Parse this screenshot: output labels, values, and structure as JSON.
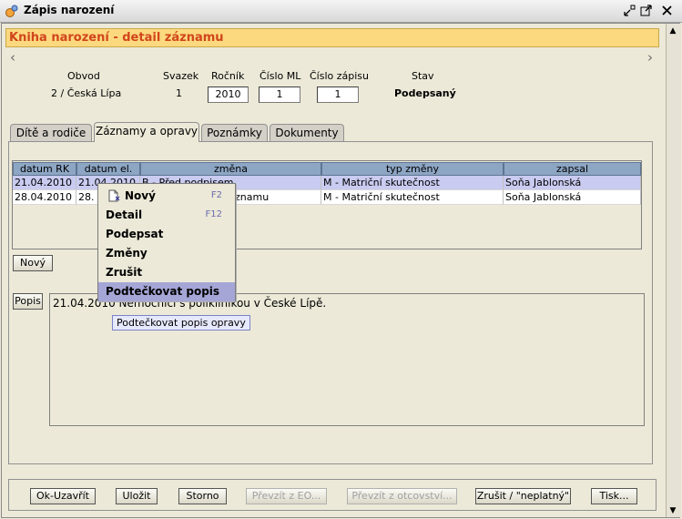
{
  "window": {
    "title": "Zápis narození"
  },
  "header": {
    "title": "Kniha narození - detail záznamu"
  },
  "record": {
    "obvod_label": "Obvod",
    "obvod_value": "2 / Česká Lípa",
    "svazek_label": "Svazek",
    "svazek_value": "1",
    "rocnik_label": "Ročník",
    "rocnik_value": "2010",
    "cislo_ml_label": "Číslo ML",
    "cislo_ml_value": "1",
    "cislo_zapisu_label": "Číslo zápisu",
    "cislo_zapisu_value": "1",
    "stav_label": "Stav",
    "stav_value": "Podepsaný"
  },
  "tabs": [
    "Dítě a rodiče",
    "Záznamy a opravy",
    "Poznámky",
    "Dokumenty"
  ],
  "table": {
    "columns": [
      "datum RK",
      "datum el.",
      "změna",
      "typ změny",
      "zapsal"
    ],
    "rows": [
      [
        "21.04.2010",
        "21.04.2010",
        "B - Před podpisem",
        "M - Matriční skutečnost",
        "Soňa Jablonská"
      ],
      [
        "28.04.2010",
        "28.",
        "znamu",
        "M - Matriční skutečnost",
        "Soňa Jablonská"
      ]
    ]
  },
  "new_button": "Nový",
  "popis": {
    "label": "Popis",
    "text": "21.04.2010 Nemocnici s poliklinikou v České Lípě.",
    "tooltip": "Podtečkovat popis opravy"
  },
  "context_menu": [
    {
      "label": "Nový",
      "shortcut": "F2",
      "icon": "new-document-icon"
    },
    {
      "label": "Detail",
      "shortcut": "F12"
    },
    {
      "label": "Podepsat",
      "shortcut": ""
    },
    {
      "label": "Změny",
      "shortcut": ""
    },
    {
      "label": "Zrušit",
      "shortcut": ""
    },
    {
      "label": "Podtečkovat popis",
      "shortcut": "",
      "highlighted": true
    }
  ],
  "footer_buttons": [
    "Ok-Uzavřít",
    "Uložit",
    "Storno",
    "Převzít z EO...",
    "Převzít z otcovství...",
    "Zrušit / \"neplatný\"",
    "Tisk..."
  ],
  "colors": {
    "header_bg": "#fcd97f",
    "header_text": "#d1451b",
    "table_header": "#8da6c4",
    "selected_row": "#c9cbf0",
    "menu_highlight": "#a5a6d6"
  }
}
